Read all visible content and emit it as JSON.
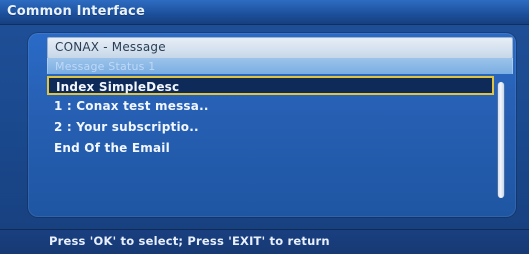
{
  "window": {
    "title": "Common Interface"
  },
  "message_panel": {
    "header": "CONAX - Message",
    "subheader": "Message Status 1"
  },
  "list": {
    "items": [
      {
        "label": "Index SimpleDesc",
        "selected": true
      },
      {
        "label": "1 : Conax test messa..",
        "selected": false
      },
      {
        "label": "2 : Your subscriptio..",
        "selected": false
      },
      {
        "label": "End Of the Email",
        "selected": false
      }
    ]
  },
  "footer": {
    "hint": "Press 'OK' to select; Press 'EXIT' to return"
  },
  "colors": {
    "background": "#1b4a90",
    "title_bar": "#1c4f9a",
    "panel": "#2760b4",
    "selection_border": "#e0c43f",
    "selection_fill": "#0e2a58",
    "footer": "#173a74",
    "text": "#f2f7ff"
  }
}
